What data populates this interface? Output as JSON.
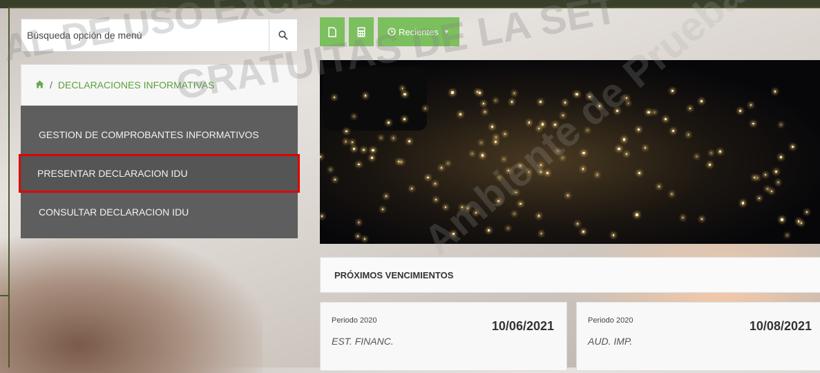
{
  "search": {
    "placeholder": "Búsqueda opción de menú"
  },
  "breadcrumb": {
    "separator": "/",
    "current": "DECLARACIONES INFORMATIVAS"
  },
  "menu": {
    "items": [
      {
        "label": "GESTION DE COMPROBANTES INFORMATIVOS"
      },
      {
        "label": "PRESENTAR DECLARACION IDU"
      },
      {
        "label": "CONSULTAR DECLARACION IDU"
      }
    ]
  },
  "toolbar": {
    "recent_label": "Recientes"
  },
  "vencimientos": {
    "title": "PRÓXIMOS VENCIMIENTOS",
    "cards": [
      {
        "period": "Periodo 2020",
        "date": "10/06/2021",
        "name": "EST. FINANC."
      },
      {
        "period": "Periodo 2020",
        "date": "10/08/2021",
        "name": "AUD. IMP."
      }
    ]
  },
  "watermarks": {
    "line1": "AL DE USO EXCLUSIVO DE LA SET",
    "line2": "GRATUITAS DE LA SET",
    "line3": "Ambiente de Pruebas"
  },
  "colors": {
    "accent": "#7cbf5e",
    "highlight": "#e00000",
    "menu_bg": "#5e5e5e"
  }
}
